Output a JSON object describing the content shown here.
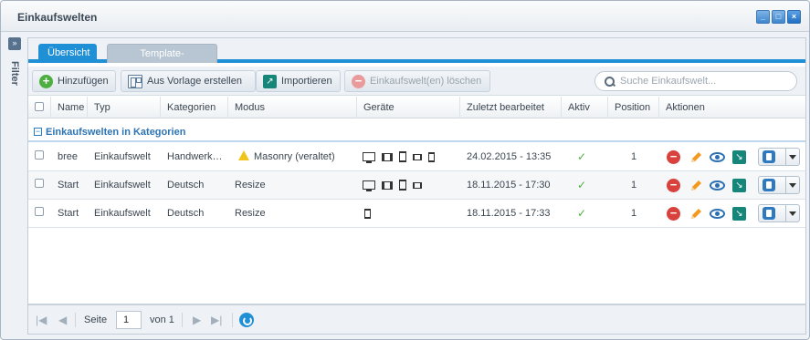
{
  "window": {
    "title": "Einkaufswelten",
    "minimize": "_",
    "maximize": "□",
    "close": "×"
  },
  "filter": {
    "toggle": "»",
    "label": "Filter"
  },
  "tabs": [
    {
      "label": "Übersicht",
      "active": true
    },
    {
      "label": "Template-Verwaltung",
      "active": false
    }
  ],
  "toolbar": {
    "add_label": "Hinzufügen",
    "from_template_label": "Aus Vorlage erstellen",
    "import_label": "Importieren",
    "delete_label": "Einkaufswelt(en) löschen",
    "search_placeholder": "Suche Einkaufswelt..."
  },
  "columns": [
    "Name",
    "Typ",
    "Kategorien",
    "Modus",
    "Geräte",
    "Zuletzt bearbeitet",
    "Aktiv",
    "Position",
    "Aktionen"
  ],
  "group": {
    "toggle": "−",
    "title": "Einkaufswelten in Kategorien"
  },
  "rows": [
    {
      "name": "bree",
      "typ": "Einkaufswelt",
      "kategorien": "Handwerk…",
      "modus": "Masonry (veraltet)",
      "modus_warning": true,
      "geraete": [
        "desktop",
        "tablet-landscape",
        "tablet-portrait",
        "mobile-landscape",
        "mobile-portrait"
      ],
      "zuletzt": "24.02.2015 - 13:35",
      "aktiv": "✓",
      "position": "1"
    },
    {
      "name": "Start",
      "typ": "Einkaufswelt",
      "kategorien": "Deutsch",
      "modus": "Resize",
      "modus_warning": false,
      "geraete": [
        "desktop",
        "tablet-landscape",
        "tablet-portrait",
        "mobile-landscape"
      ],
      "zuletzt": "18.11.2015 - 17:30",
      "aktiv": "✓",
      "position": "1"
    },
    {
      "name": "Start",
      "typ": "Einkaufswelt",
      "kategorien": "Deutsch",
      "modus": "Resize",
      "modus_warning": false,
      "geraete": [
        "mobile-portrait"
      ],
      "zuletzt": "18.11.2015 - 17:33",
      "aktiv": "✓",
      "position": "1"
    }
  ],
  "pager": {
    "first": "|◀",
    "prev": "◀",
    "page_label": "Seite",
    "page_value": "1",
    "of_label": "von 1",
    "next": "▶",
    "last": "▶|"
  }
}
